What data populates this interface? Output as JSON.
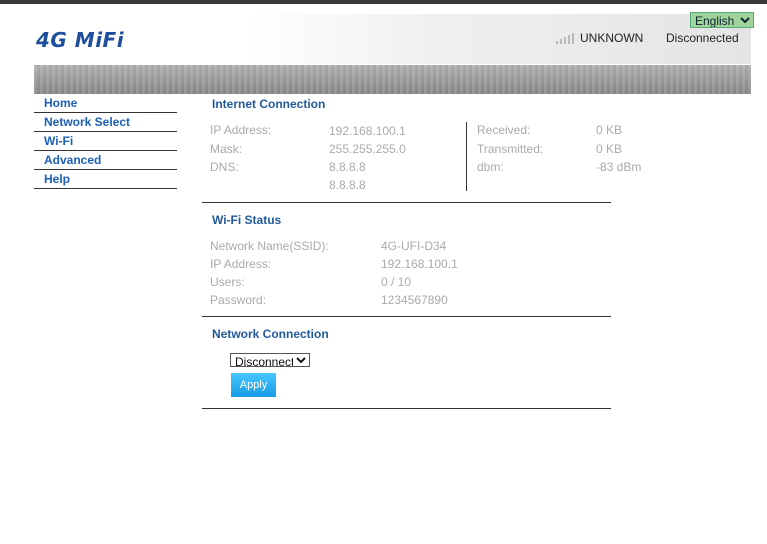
{
  "header": {
    "logo_text": "4G MiFi",
    "language": {
      "selected": "English",
      "options": [
        "English"
      ]
    },
    "network_status": "UNKNOWN",
    "connection_status": "Disconnected"
  },
  "menu": {
    "items": [
      "Home",
      "Network Select",
      "Wi-Fi",
      "Advanced",
      "Help"
    ]
  },
  "internet": {
    "title": "Internet Connection",
    "ip_label": "IP Address:",
    "ip_value": "192.168.100.1",
    "mask_label": "Mask:",
    "mask_value": "255.255.255.0",
    "dns_label": "DNS:",
    "dns1_value": "8.8.8.8",
    "dns2_value": "8.8.8.8",
    "received_label": "Received:",
    "received_value": "0 KB",
    "transmitted_label": "Transmitted:",
    "transmitted_value": "0 KB",
    "dbm_label": "dbm:",
    "dbm_value": "-83 dBm"
  },
  "wifi": {
    "title": "Wi-Fi Status",
    "ssid_label": "Network Name(SSID):",
    "ssid_value": "4G-UFI-D34",
    "ip_label": "IP Address:",
    "ip_value": "192.168.100.1",
    "users_label": "Users:",
    "users_value": "0 / 10",
    "password_label": "Password:",
    "password_value": "1234567890"
  },
  "network_connection": {
    "title": "Network Connection",
    "mode": {
      "selected": "Disconnect",
      "options": [
        "Disconnect"
      ]
    },
    "apply_label": "Apply"
  }
}
